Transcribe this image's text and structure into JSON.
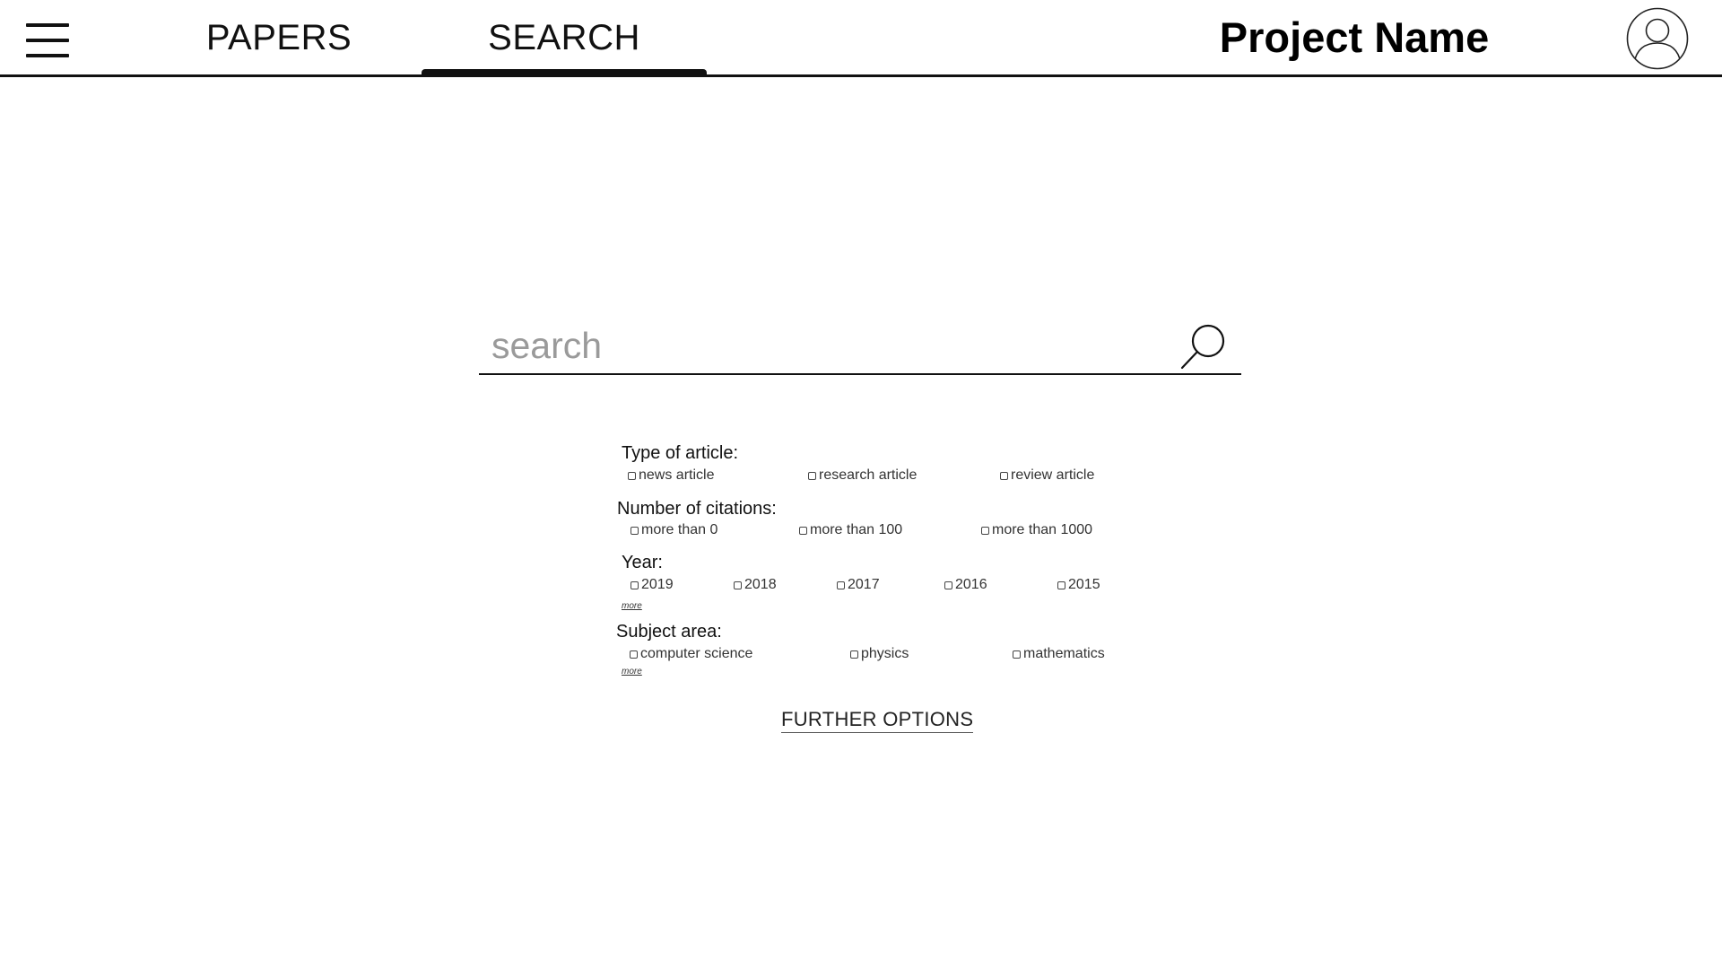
{
  "nav": {
    "menu_icon": "hamburger-menu-icon",
    "tabs": [
      {
        "label": "PAPERS",
        "active": false
      },
      {
        "label": "SEARCH",
        "active": true
      }
    ],
    "project_name": "Project Name",
    "avatar_icon": "user-avatar-icon"
  },
  "search": {
    "placeholder": "search",
    "value": "",
    "icon": "search-icon"
  },
  "filters": {
    "article_type": {
      "title": "Type of article:",
      "options": [
        "news article",
        "research article",
        "review article"
      ]
    },
    "citations": {
      "title": "Number of citations:",
      "options": [
        "more than 0",
        "more than 100",
        "more than 1000"
      ]
    },
    "year": {
      "title": "Year:",
      "options": [
        "2019",
        "2018",
        "2017",
        "2016",
        "2015"
      ],
      "more": "more"
    },
    "subject": {
      "title": "Subject area:",
      "options": [
        "computer science",
        "physics",
        "mathematics"
      ],
      "more": "more"
    }
  },
  "further_options": "FURTHER OPTIONS",
  "colors": {
    "text": "#111111",
    "placeholder": "#9a9a9a",
    "background": "#ffffff"
  }
}
